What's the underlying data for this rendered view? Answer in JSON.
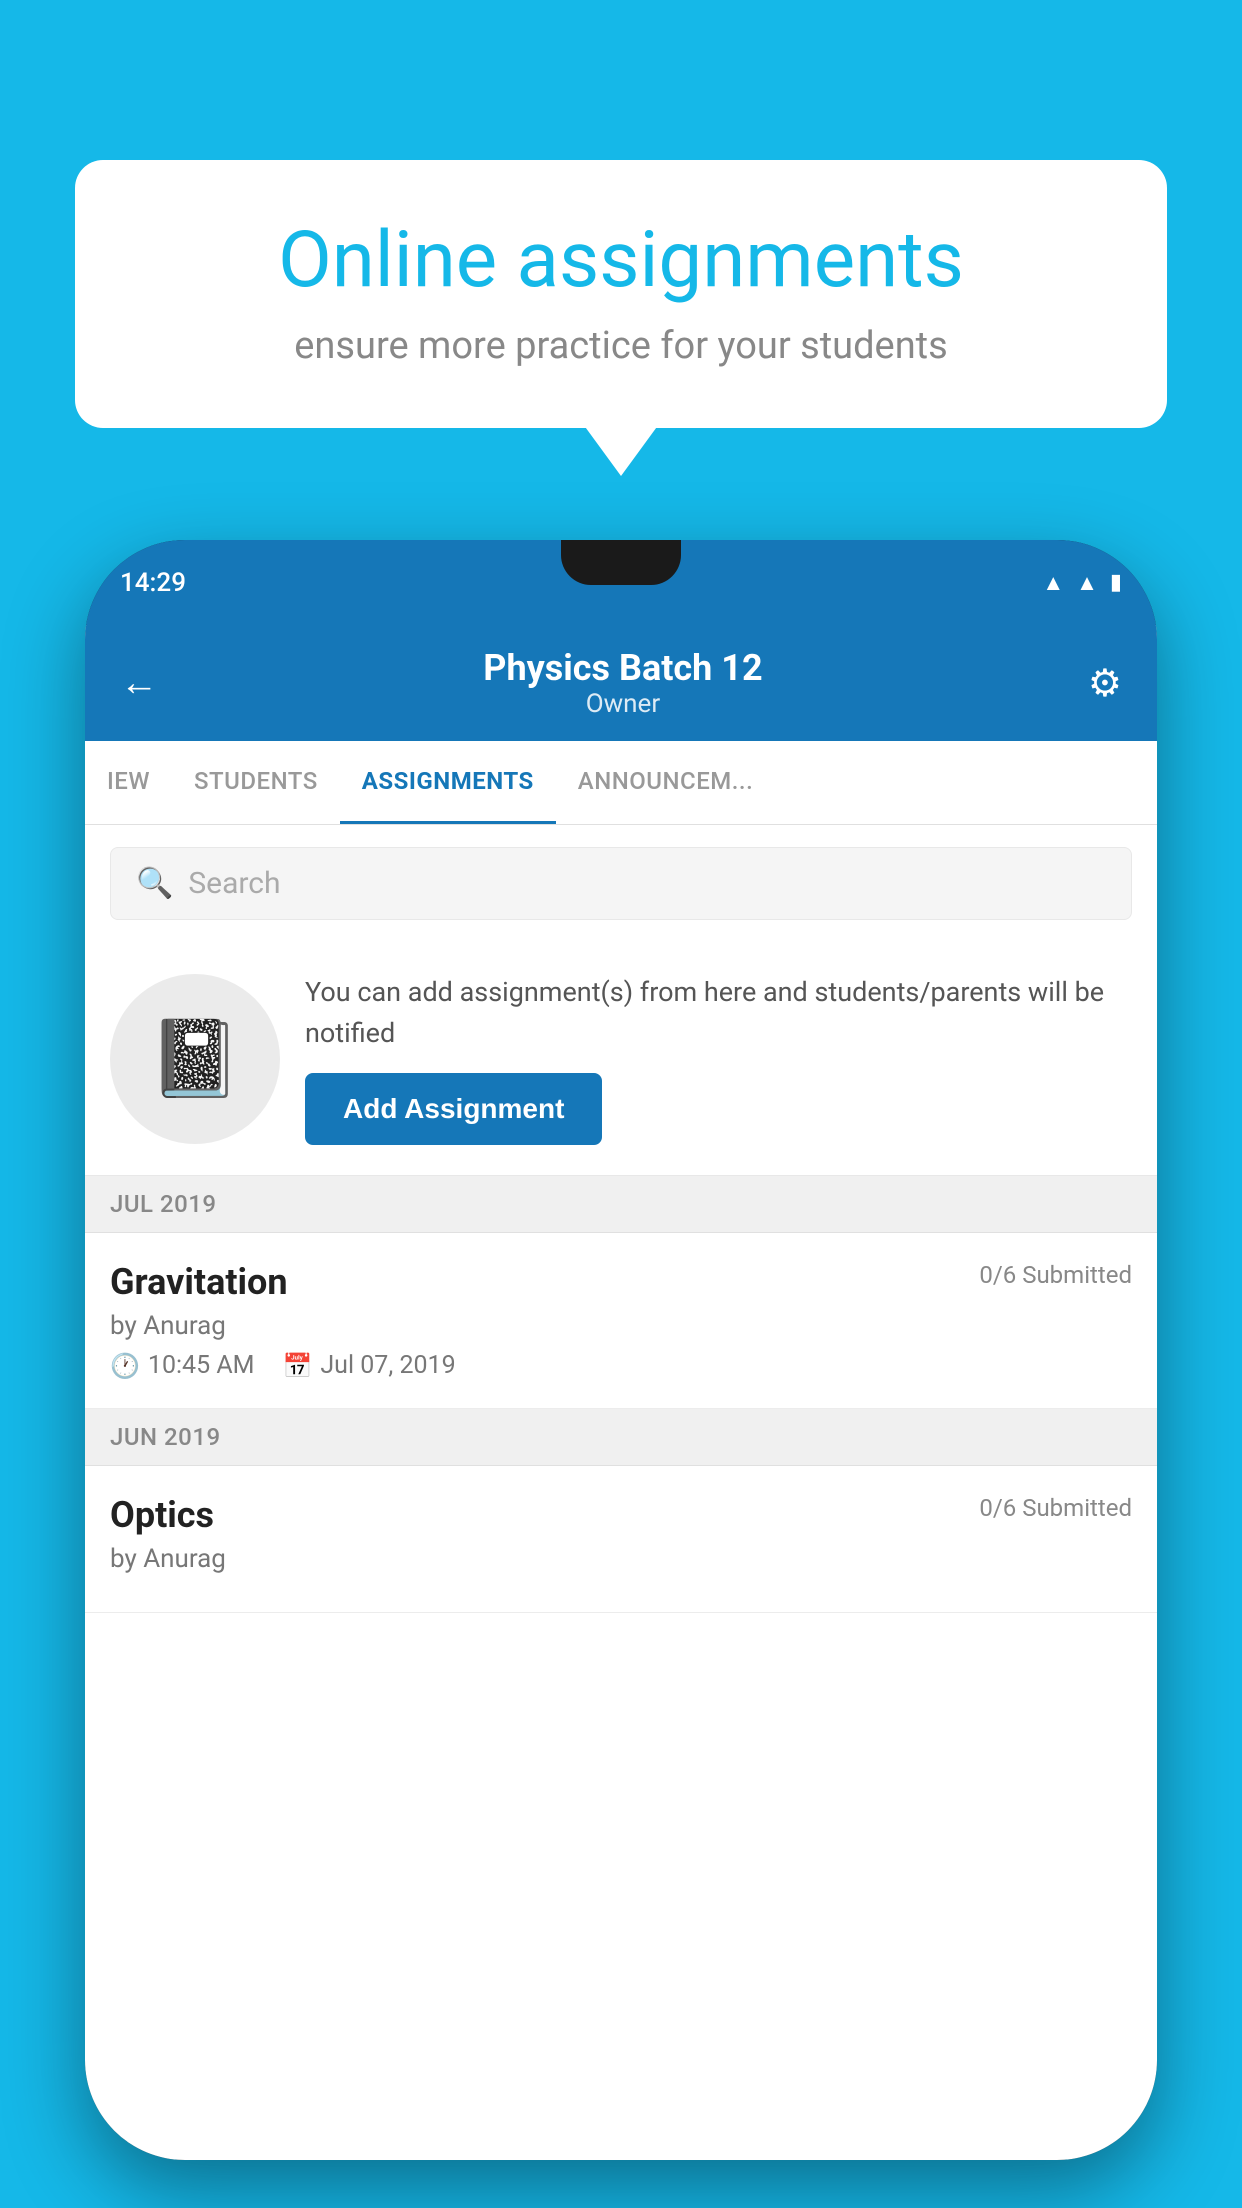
{
  "background_color": "#15b8e8",
  "speech_bubble": {
    "title": "Online assignments",
    "subtitle": "ensure more practice for your students"
  },
  "status_bar": {
    "time": "14:29",
    "wifi_icon": "wifi",
    "signal_icon": "signal",
    "battery_icon": "battery"
  },
  "app_header": {
    "title": "Physics Batch 12",
    "subtitle": "Owner",
    "back_label": "←",
    "gear_label": "⚙"
  },
  "tabs": [
    {
      "label": "IEW",
      "active": false
    },
    {
      "label": "STUDENTS",
      "active": false
    },
    {
      "label": "ASSIGNMENTS",
      "active": true
    },
    {
      "label": "ANNOUNCEM...",
      "active": false
    }
  ],
  "search": {
    "placeholder": "Search"
  },
  "promo": {
    "description": "You can add assignment(s) from here and students/parents will be notified",
    "button_label": "Add Assignment"
  },
  "sections": [
    {
      "month": "JUL 2019",
      "assignments": [
        {
          "title": "Gravitation",
          "submitted": "0/6 Submitted",
          "by": "by Anurag",
          "time": "10:45 AM",
          "date": "Jul 07, 2019"
        }
      ]
    },
    {
      "month": "JUN 2019",
      "assignments": [
        {
          "title": "Optics",
          "submitted": "0/6 Submitted",
          "by": "by Anurag",
          "time": "",
          "date": ""
        }
      ]
    }
  ]
}
